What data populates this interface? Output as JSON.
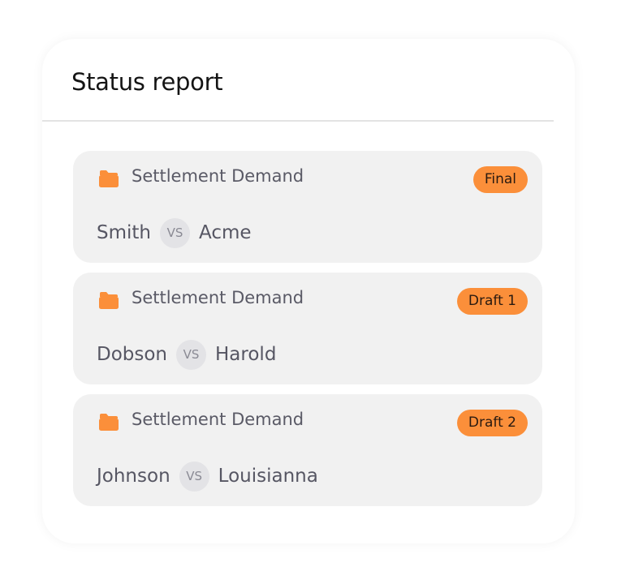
{
  "header": {
    "title": "Status report"
  },
  "accent_color": "#fb8f3a",
  "cards": [
    {
      "icon": "folder-icon",
      "type": "Settlement Demand",
      "status": "Final",
      "plaintiff": "Smith",
      "vs": "VS",
      "defendant": "Acme"
    },
    {
      "icon": "folder-icon",
      "type": "Settlement Demand",
      "status": "Draft 1",
      "plaintiff": "Dobson",
      "vs": "VS",
      "defendant": "Harold"
    },
    {
      "icon": "folder-icon",
      "type": "Settlement Demand",
      "status": "Draft 2",
      "plaintiff": "Johnson",
      "vs": "VS",
      "defendant": "Louisianna"
    }
  ]
}
